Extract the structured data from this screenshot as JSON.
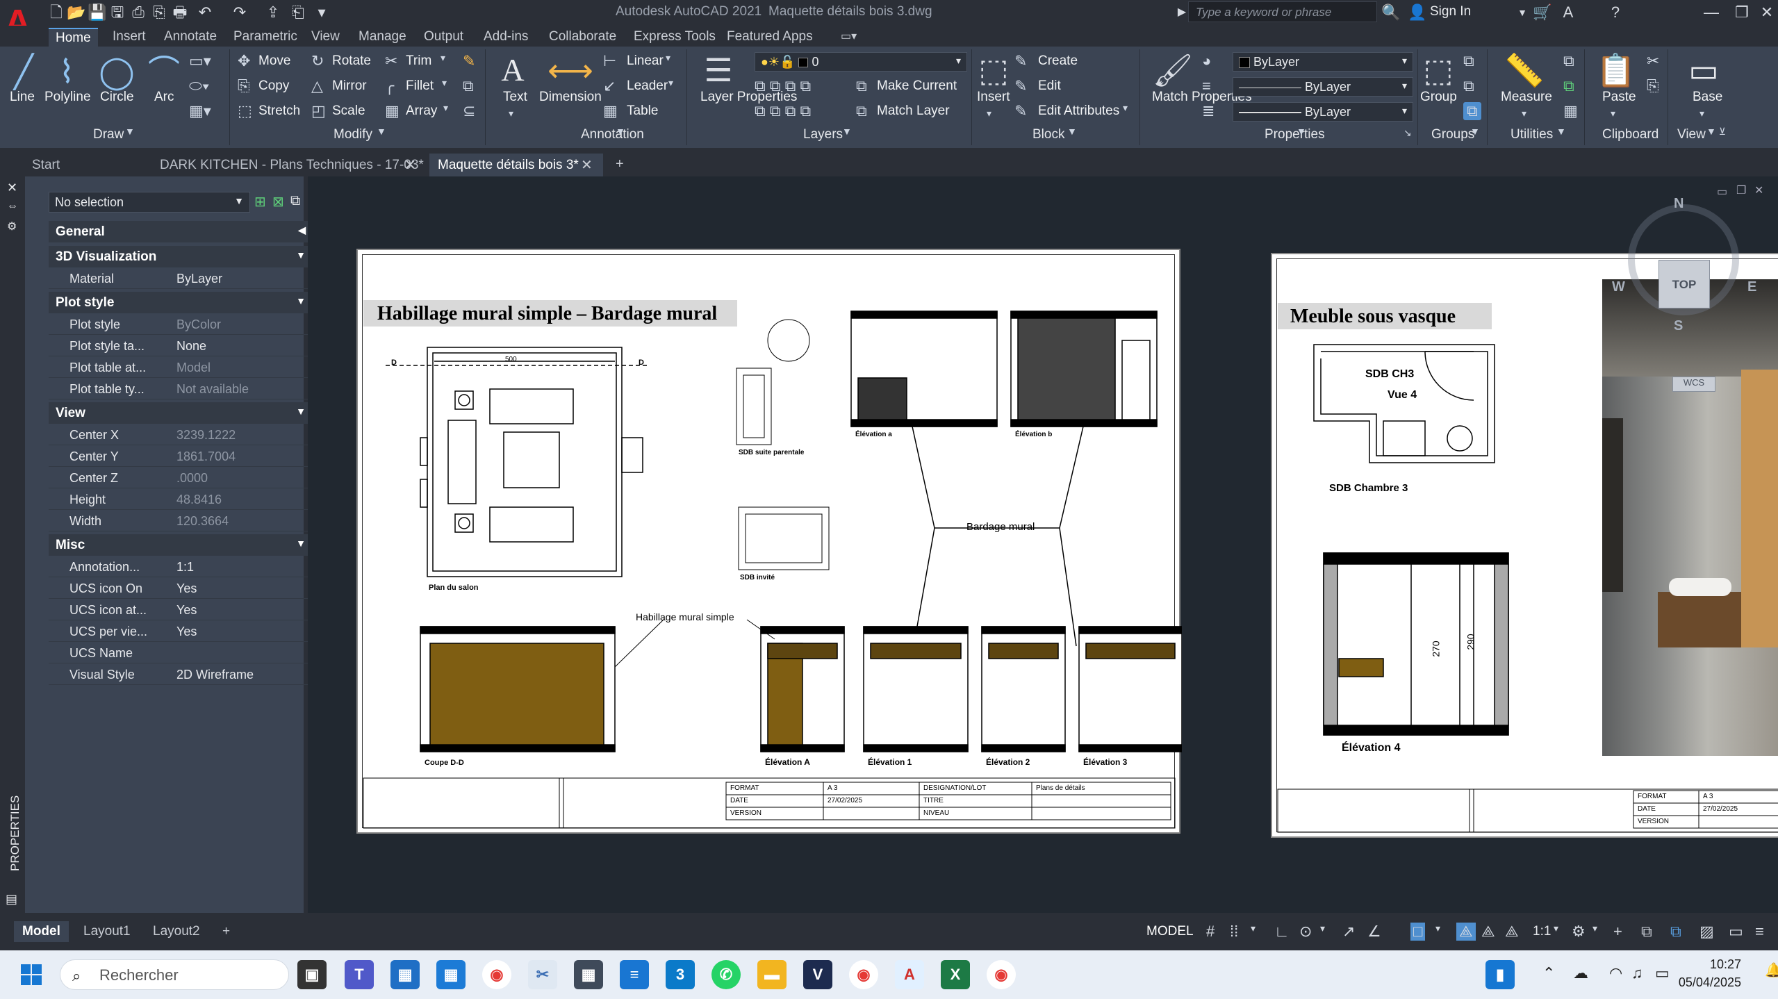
{
  "app": {
    "title": "Autodesk AutoCAD 2021",
    "file": "Maquette détails bois 3.dwg",
    "search_placeholder": "Type a keyword or phrase",
    "sign_in": "Sign In"
  },
  "ribbon_tabs": [
    "Home",
    "Insert",
    "Annotate",
    "Parametric",
    "View",
    "Manage",
    "Output",
    "Add-ins",
    "Collaborate",
    "Express Tools",
    "Featured Apps"
  ],
  "ribbon": {
    "draw": {
      "label": "Draw",
      "line": "Line",
      "polyline": "Polyline",
      "circle": "Circle",
      "arc": "Arc"
    },
    "modify": {
      "label": "Modify",
      "move": "Move",
      "rotate": "Rotate",
      "trim": "Trim",
      "copy": "Copy",
      "mirror": "Mirror",
      "fillet": "Fillet",
      "stretch": "Stretch",
      "scale": "Scale",
      "array": "Array"
    },
    "annotation": {
      "label": "Annotation",
      "text": "Text",
      "dimension": "Dimension",
      "linear": "Linear",
      "leader": "Leader",
      "table": "Table"
    },
    "layers": {
      "label": "Layers",
      "layer_properties": "Layer Properties",
      "current_layer": "0",
      "make_current": "Make Current",
      "match_layer": "Match Layer"
    },
    "block": {
      "label": "Block",
      "insert": "Insert",
      "create": "Create",
      "edit": "Edit",
      "edit_attributes": "Edit Attributes"
    },
    "properties": {
      "label": "Properties",
      "match_properties": "Match Properties",
      "color": "ByLayer",
      "linetype": "ByLayer",
      "lineweight": "ByLayer"
    },
    "groups": {
      "label": "Groups",
      "group": "Group"
    },
    "utilities": {
      "label": "Utilities",
      "measure": "Measure"
    },
    "clipboard": {
      "label": "Clipboard",
      "paste": "Paste"
    },
    "view": {
      "label": "View",
      "base": "Base"
    }
  },
  "doc_tabs": [
    "Start",
    "DARK KITCHEN - Plans Techniques - 17-03*",
    "Maquette détails bois 3*"
  ],
  "palette": {
    "selection": "No selection",
    "vertical_title": "PROPERTIES",
    "sections": {
      "general": "General",
      "viz": "3D Visualization",
      "plot": "Plot style",
      "view": "View",
      "misc": "Misc"
    },
    "rows": {
      "material": {
        "k": "Material",
        "v": "ByLayer"
      },
      "plot_style": {
        "k": "Plot style",
        "v": "ByColor"
      },
      "plot_style_table": {
        "k": "Plot style ta...",
        "v": "None"
      },
      "plot_table_at": {
        "k": "Plot table at...",
        "v": "Model"
      },
      "plot_table_ty": {
        "k": "Plot table ty...",
        "v": "Not available"
      },
      "center_x": {
        "k": "Center X",
        "v": "3239.1222"
      },
      "center_y": {
        "k": "Center Y",
        "v": "1861.7004"
      },
      "center_z": {
        "k": "Center Z",
        "v": ".0000"
      },
      "height": {
        "k": "Height",
        "v": "48.8416"
      },
      "width": {
        "k": "Width",
        "v": "120.3664"
      },
      "annotation": {
        "k": "Annotation...",
        "v": "1:1"
      },
      "ucs_icon_on": {
        "k": "UCS icon On",
        "v": "Yes"
      },
      "ucs_icon_at": {
        "k": "UCS icon at...",
        "v": "Yes"
      },
      "ucs_per_vie": {
        "k": "UCS per vie...",
        "v": "Yes"
      },
      "ucs_name": {
        "k": "UCS Name",
        "v": ""
      },
      "visual_style": {
        "k": "Visual Style",
        "v": "2D Wireframe"
      }
    }
  },
  "drawing": {
    "sheet1": {
      "title": "Habillage mural simple – Bardage mural",
      "plan_label": "Plan du salon",
      "dim_500": "500",
      "section_mark": "D",
      "coupe_label": "Coupe D-D",
      "habillage_label": "Habillage mural simple",
      "bardage_label": "Bardage mural",
      "sdb_suite_label": "SDB suite parentale",
      "sdb_invite_label": "SDB invité",
      "elev_a_small": "Élévation a",
      "elev_b_small": "Élévation b",
      "elev_A": "Élévation A",
      "elev_1": "Élévation 1",
      "elev_2": "Élévation 2",
      "elev_3": "Élévation 3",
      "title_block": {
        "format_k": "FORMAT",
        "format_v": "A 3",
        "date_k": "DATE",
        "date_v": "27/02/2025",
        "version_k": "VERSION",
        "designation_k": "DESIGNATION/LOT",
        "designation_v": "Plans de détails",
        "titre_k": "TITRE",
        "niveau_k": "NIVEAU"
      }
    },
    "sheet2": {
      "title": "Meuble sous vasque",
      "room_label": "SDB CH3",
      "vue_label": "Vue 4",
      "plan_label": "SDB Chambre 3",
      "elev_label": "Élévation 4",
      "dim_270": "270",
      "dim_290": "290",
      "title_block": {
        "format_k": "FORMAT",
        "format_v": "A 3",
        "date_k": "DATE",
        "date_v": "27/02/2025",
        "version_k": "VERSION"
      }
    },
    "viewcube": {
      "north": "N",
      "south": "S",
      "east": "E",
      "west": "W",
      "top": "TOP",
      "wcs": "WCS"
    }
  },
  "layout_tabs": [
    "Model",
    "Layout1",
    "Layout2"
  ],
  "status": {
    "model": "MODEL",
    "scale": "1:1"
  },
  "taskbar": {
    "search": "Rechercher",
    "time": "10:27",
    "date": "05/04/2025"
  }
}
